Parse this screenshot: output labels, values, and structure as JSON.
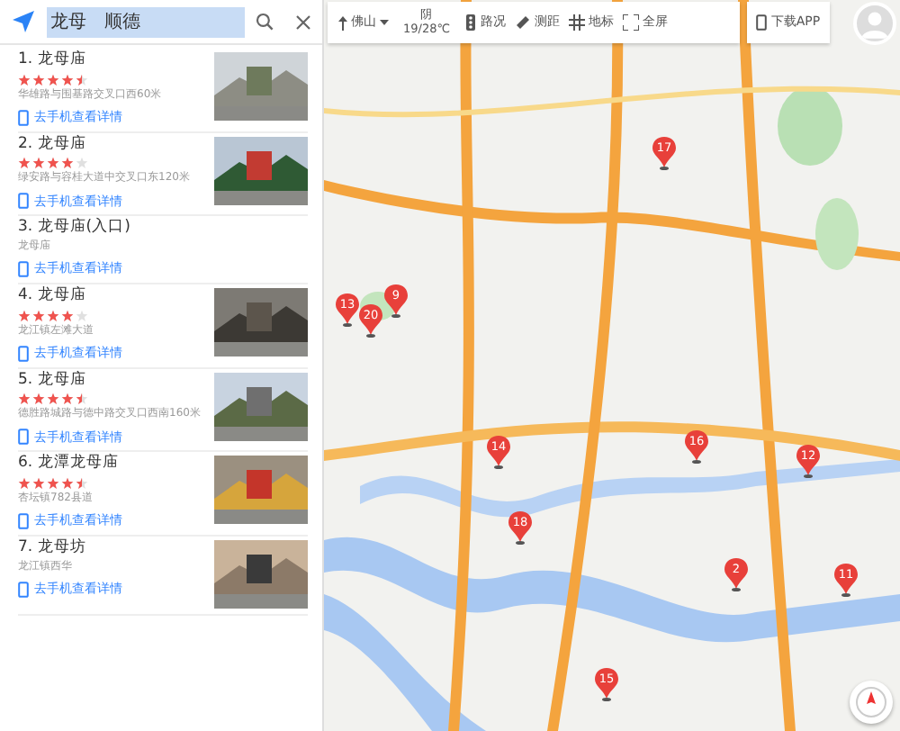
{
  "search": {
    "value": "龙母　顺德",
    "highlighted": true
  },
  "results": [
    {
      "title": "1. 龙母庙",
      "stars": 4.5,
      "address": "华雄路与围基路交叉口西60米",
      "link": "去手机查看详情",
      "photo": true
    },
    {
      "title": "2. 龙母庙",
      "stars": 4,
      "address": "绿安路与容桂大道中交叉口东120米",
      "link": "去手机查看详情",
      "photo": true
    },
    {
      "title": "3. 龙母庙(入口)",
      "address": "龙母庙",
      "link": "去手机查看详情",
      "photo": false
    },
    {
      "title": "4. 龙母庙",
      "stars": 4,
      "address": "龙江镇左滩大道",
      "link": "去手机查看详情",
      "photo": true
    },
    {
      "title": "5. 龙母庙",
      "stars": 4.5,
      "address": "德胜路城路与德中路交叉口西南160米",
      "link": "去手机查看详情",
      "photo": true
    },
    {
      "title": "6. 龙潭龙母庙",
      "stars": 4.5,
      "address": "杏坛镇782县道",
      "link": "去手机查看详情",
      "photo": true
    },
    {
      "title": "7. 龙母坊",
      "address": "龙江镇西华",
      "link": "去手机查看详情",
      "photo": true
    }
  ],
  "toolbar": {
    "city": "佛山",
    "weather": "阴",
    "temperature": "19/28℃",
    "tools": [
      {
        "kind": "traffic",
        "label": "路况"
      },
      {
        "kind": "measure",
        "label": "测距"
      },
      {
        "kind": "landmark",
        "label": "地标"
      },
      {
        "kind": "fullscreen",
        "label": "全屏"
      }
    ],
    "download": "下载APP"
  },
  "markers": [
    {
      "label": "17"
    },
    {
      "label": "9"
    },
    {
      "label": "13"
    },
    {
      "label": "20"
    },
    {
      "label": "14"
    },
    {
      "label": "16"
    },
    {
      "label": "12"
    },
    {
      "label": "18"
    },
    {
      "label": "2"
    },
    {
      "label": "11"
    },
    {
      "label": "15"
    }
  ]
}
